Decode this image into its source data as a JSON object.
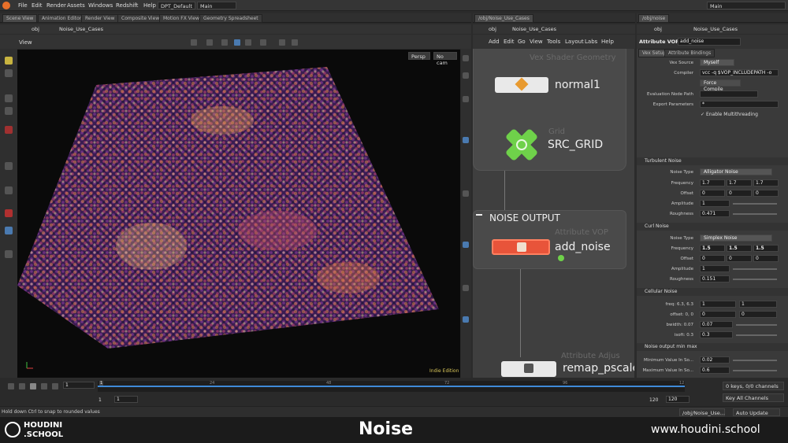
{
  "menu": {
    "items": [
      "File",
      "Edit",
      "Render",
      "Assets",
      "Windows",
      "Redshift",
      "Help"
    ],
    "dop": "DPT_Default",
    "desk": "Main",
    "desk_right": "Main"
  },
  "tabs_left": [
    "Scene View",
    "Animation Editor",
    "Render View",
    "Composite View",
    "Motion FX View",
    "Geometry Spreadsheet"
  ],
  "tabs_mid": [
    "/obj/Noise_Use_Cases"
  ],
  "tabs_right": [
    "/obj/noise"
  ],
  "path": {
    "obj": "obj",
    "net": "Noise_Use_Cases"
  },
  "viewport": {
    "title": "View",
    "persp": "Persp",
    "cam": "No cam",
    "edition": "Indie Edition"
  },
  "network_menu": [
    "Add",
    "Edit",
    "Go",
    "View",
    "Tools",
    "Layout",
    "Labs",
    "Help"
  ],
  "nodes": {
    "n1": "normal1",
    "n2": "SRC_GRID",
    "n3": "add_noise",
    "n4": "remap_pscale",
    "ghost1": "Vex Shader Geometry",
    "ghost2": "Grid",
    "ghost3": "Attribute VOP",
    "ghost4": "Attribute Adjus",
    "box_title": "NOISE OUTPUT"
  },
  "params": {
    "type_label": "Attribute VOP",
    "node_name": "add_noise",
    "tabs": [
      "Vex Setup",
      "Attribute Bindings"
    ],
    "vex_source_label": "Vex Source",
    "vex_source": "Myself",
    "compiler_label": "Compiler",
    "compiler": "vcc -q $VOP_INCLUDEPATH -o",
    "force_compile": "Force Compile",
    "eval_path_label": "Evaluation Node Path",
    "export_label": "Export Parameters",
    "export_value": "*",
    "multithread": "Enable Multithreading",
    "turb": {
      "section": "Turbulent Noise",
      "type_label": "Noise Type",
      "type": "Alligator Noise",
      "freq_label": "Frequency",
      "freq": [
        "1.7",
        "1.7",
        "1.7"
      ],
      "offset_label": "Offset",
      "offset": [
        "0",
        "0",
        "0"
      ],
      "amp_label": "Amplitude",
      "amp": "1",
      "rough_label": "Roughness",
      "rough": "0.471"
    },
    "curl": {
      "section": "Curl Noise",
      "type_label": "Noise Type",
      "type": "Simplex Noise",
      "freq_label": "Frequency",
      "freq": [
        "1.5",
        "1.5",
        "1.5"
      ],
      "offset_label": "Offset",
      "offset": [
        "0",
        "0",
        "0"
      ],
      "amp_label": "Amplitude",
      "amp": "1",
      "rough_label": "Roughness",
      "rough": "0.151"
    },
    "cell": {
      "section": "Cellular Noise",
      "freq_label": "freq: 6.3, 6.3",
      "freq": [
        "1",
        "1"
      ],
      "offset_label": "offset: 0, 0",
      "offset": [
        "0",
        "0"
      ],
      "bwidth_label": "bwidth: 0.07",
      "bwidth": "0.07",
      "isoft_label": "isoft: 0.3",
      "isoft": "0.3"
    },
    "remap": {
      "section": "Noise output min max",
      "min_label": "Minimum Value In So...",
      "min": "0.02",
      "max_label": "Maximum Value In So...",
      "max": "0.6"
    }
  },
  "timeline": {
    "frame": "1",
    "start": "1",
    "start2": "1",
    "end": "120",
    "end2": "120",
    "ticks": [
      "1",
      "24",
      "48",
      "72",
      "96",
      "12"
    ],
    "keys": "0 keys, 0/0 channels",
    "key_all": "Key All Channels",
    "auto_update": "Auto Update",
    "path": "/obj/Noise_Use..."
  },
  "status": "Hold down Ctrl to snap to rounded values",
  "footer": {
    "logo1": "HOUDINI",
    "logo2": ".SCHOOL",
    "title": "Noise",
    "url": "www.houdini.school"
  },
  "colors": {
    "accent": "#e8543a",
    "green": "#6fd14a",
    "timeline_blue": "#3f8ad8"
  }
}
